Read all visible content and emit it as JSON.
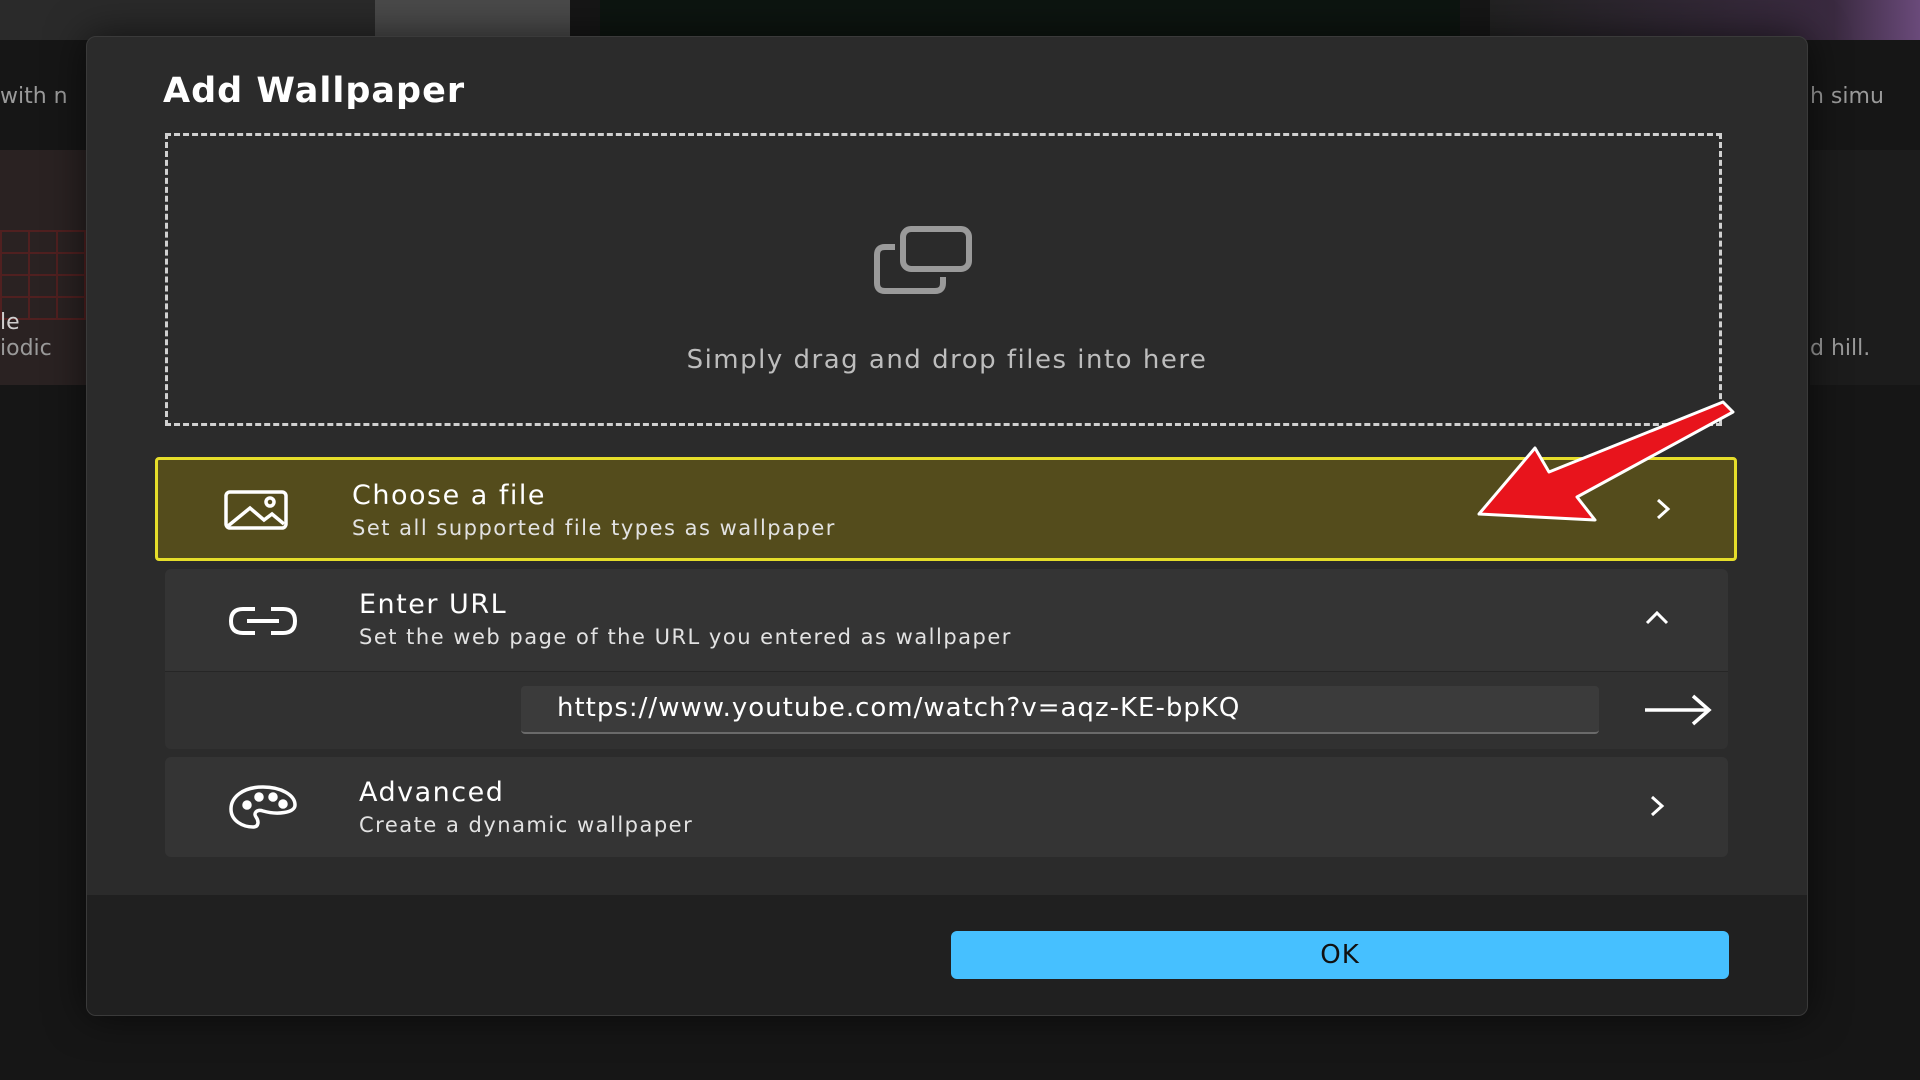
{
  "background": {
    "snippet_1": "with n",
    "snippet_2": "le",
    "snippet_3": "iodic",
    "snippet_4": "h simu",
    "snippet_5": "d hill."
  },
  "dialog": {
    "title": "Add Wallpaper",
    "drop_zone": {
      "icon": "copy-icon",
      "text": "Simply drag and drop files into here"
    },
    "options": {
      "choose_file": {
        "icon": "image-icon",
        "title": "Choose a file",
        "subtitle": "Set all supported file types as wallpaper",
        "highlight_color": "#e6de2a"
      },
      "enter_url": {
        "icon": "link-icon",
        "title": "Enter URL",
        "subtitle": "Set the web page of the URL you entered as wallpaper",
        "url_value": "https://www.youtube.com/watch?v=aqz-KE-bpKQ"
      },
      "advanced": {
        "icon": "palette-icon",
        "title": "Advanced",
        "subtitle": "Create a dynamic wallpaper"
      }
    },
    "ok_label": "OK",
    "accent_color": "#46c0ff",
    "annotation_arrow_color": "#e8141c"
  }
}
